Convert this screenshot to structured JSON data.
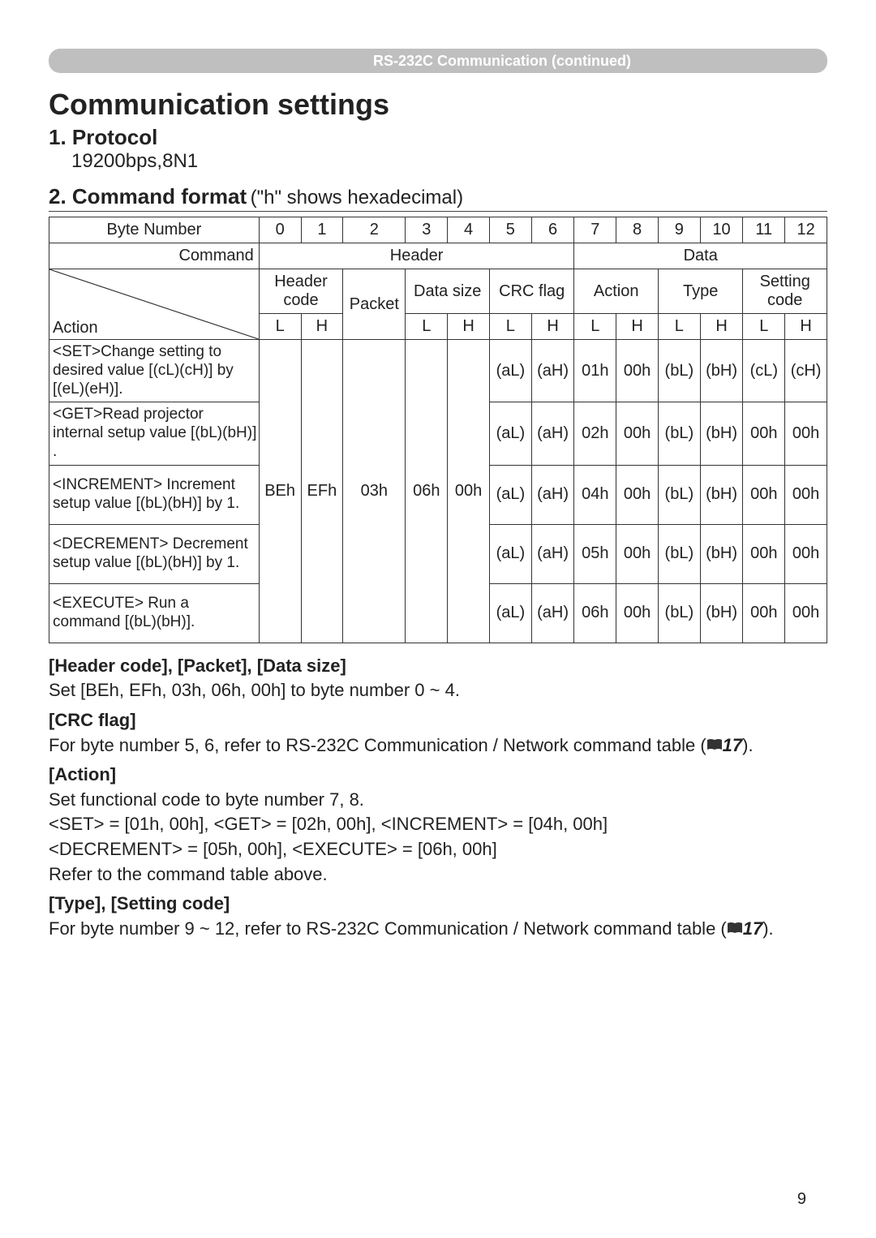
{
  "header_bar": "RS-232C Communication (continued)",
  "title": "Communication settings",
  "section1_title": "1. Protocol",
  "protocol_value": "19200bps,8N1",
  "section2_title": "2. Command format",
  "section2_note": "  (\"h\" shows hexadecimal)",
  "table": {
    "byte_number_label": "Byte Number",
    "byte_numbers": [
      "0",
      "1",
      "2",
      "3",
      "4",
      "5",
      "6",
      "7",
      "8",
      "9",
      "10",
      "11",
      "12"
    ],
    "command_label": "Command",
    "action_diag_label": "Action",
    "header_group": "Header",
    "data_group": "Data",
    "header_code": "Header code",
    "packet": "Packet",
    "data_size": "Data size",
    "crc_flag": "CRC flag",
    "action_col": "Action",
    "type_col": "Type",
    "setting_code": "Setting code",
    "action_label": "Action",
    "lh": [
      "L",
      "H"
    ],
    "fixed_header": {
      "code_L": "BEh",
      "code_H": "EFh",
      "packet": "03h",
      "size_L": "06h",
      "size_H": "00h"
    },
    "rows": [
      {
        "desc": "<SET>Change setting to desired value [(cL)(cH)] by [(eL)(eH)].",
        "crc_L": "(aL)",
        "crc_H": "(aH)",
        "act_L": "01h",
        "act_H": "00h",
        "type_L": "(bL)",
        "type_H": "(bH)",
        "set_L": "(cL)",
        "set_H": "(cH)"
      },
      {
        "desc": "<GET>Read projector internal setup value [(bL)(bH)] .",
        "crc_L": "(aL)",
        "crc_H": "(aH)",
        "act_L": "02h",
        "act_H": "00h",
        "type_L": "(bL)",
        "type_H": "(bH)",
        "set_L": "00h",
        "set_H": "00h"
      },
      {
        "desc": "<INCREMENT> Increment setup value [(bL)(bH)] by 1.",
        "crc_L": "(aL)",
        "crc_H": "(aH)",
        "act_L": "04h",
        "act_H": "00h",
        "type_L": "(bL)",
        "type_H": "(bH)",
        "set_L": "00h",
        "set_H": "00h"
      },
      {
        "desc": "<DECREMENT> Decrement setup value [(bL)(bH)] by 1.",
        "crc_L": "(aL)",
        "crc_H": "(aH)",
        "act_L": "05h",
        "act_H": "00h",
        "type_L": "(bL)",
        "type_H": "(bH)",
        "set_L": "00h",
        "set_H": "00h"
      },
      {
        "desc": "<EXECUTE> Run a command [(bL)(bH)].",
        "crc_L": "(aL)",
        "crc_H": "(aH)",
        "act_L": "06h",
        "act_H": "00h",
        "type_L": "(bL)",
        "type_H": "(bH)",
        "set_L": "00h",
        "set_H": "00h"
      }
    ]
  },
  "notes": {
    "n1_title": "[Header code], [Packet], [Data size]",
    "n1_body": "Set [BEh, EFh, 03h, 06h, 00h] to byte number 0 ~ 4.",
    "n2_title": "[CRC flag]",
    "n2_body_a": "For byte number 5, 6, refer to RS-232C Communication / Network command table (",
    "n2_ref": "17",
    "n2_body_b": ").",
    "n3_title": "[Action]",
    "n3_line1": "Set functional code to byte number 7, 8.",
    "n3_line2": "<SET> = [01h, 00h], <GET> = [02h, 00h], <INCREMENT> = [04h, 00h]",
    "n3_line3": "<DECREMENT> = [05h, 00h], <EXECUTE> = [06h, 00h]",
    "n3_line4": "Refer to the command table above.",
    "n4_title": "[Type], [Setting code]",
    "n4_body_a": "For byte number 9 ~ 12, refer to RS-232C Communication / Network command table (",
    "n4_ref": "17",
    "n4_body_b": ")."
  },
  "page_number": "9"
}
